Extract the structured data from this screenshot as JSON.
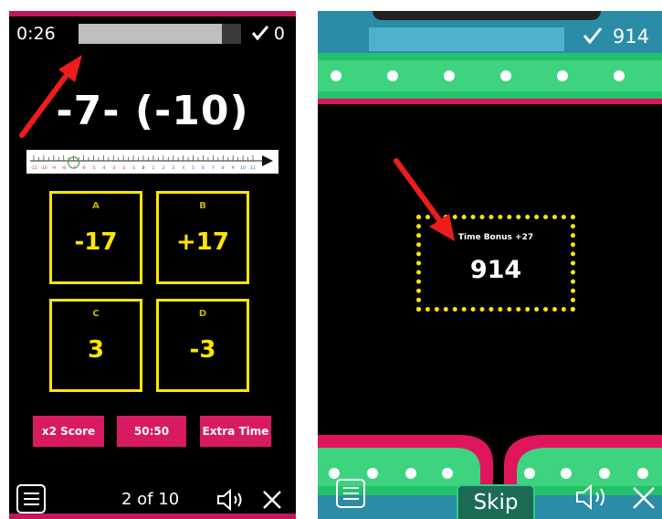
{
  "left_screen": {
    "timer": "0:26",
    "timer_fraction_remaining": 0.88,
    "score": "0",
    "question": "-7- (-10)",
    "number_line_ticks": [
      "-11",
      "-10",
      "-9",
      "-8",
      "-7",
      "-6",
      "-5",
      "-4",
      "-3",
      "-2",
      "-1",
      "0",
      "1",
      "2",
      "3",
      "4",
      "5",
      "6",
      "7",
      "8",
      "9",
      "10",
      "11"
    ],
    "answers": [
      {
        "letter": "A",
        "value": "-17"
      },
      {
        "letter": "B",
        "value": "+17"
      },
      {
        "letter": "C",
        "value": "3"
      },
      {
        "letter": "D",
        "value": "-3"
      }
    ],
    "lifelines": [
      "x2 Score",
      "50:50",
      "Extra Time"
    ],
    "progress": "2 of 10",
    "icons": [
      "check-icon",
      "menu-icon",
      "speaker-icon",
      "close-icon"
    ]
  },
  "right_screen": {
    "score": "914",
    "bonus_label": "Time Bonus +27",
    "bonus_score": "914",
    "skip_label": "Skip",
    "icons": [
      "check-icon",
      "menu-icon",
      "speaker-icon",
      "close-icon"
    ]
  },
  "colors": {
    "accent_pink": "#d81b60",
    "answer_yellow": "#ffe600",
    "light_green": "#3ed37f",
    "top_blue": "#2a8ca6",
    "arrow_red": "#ee1c1c"
  }
}
